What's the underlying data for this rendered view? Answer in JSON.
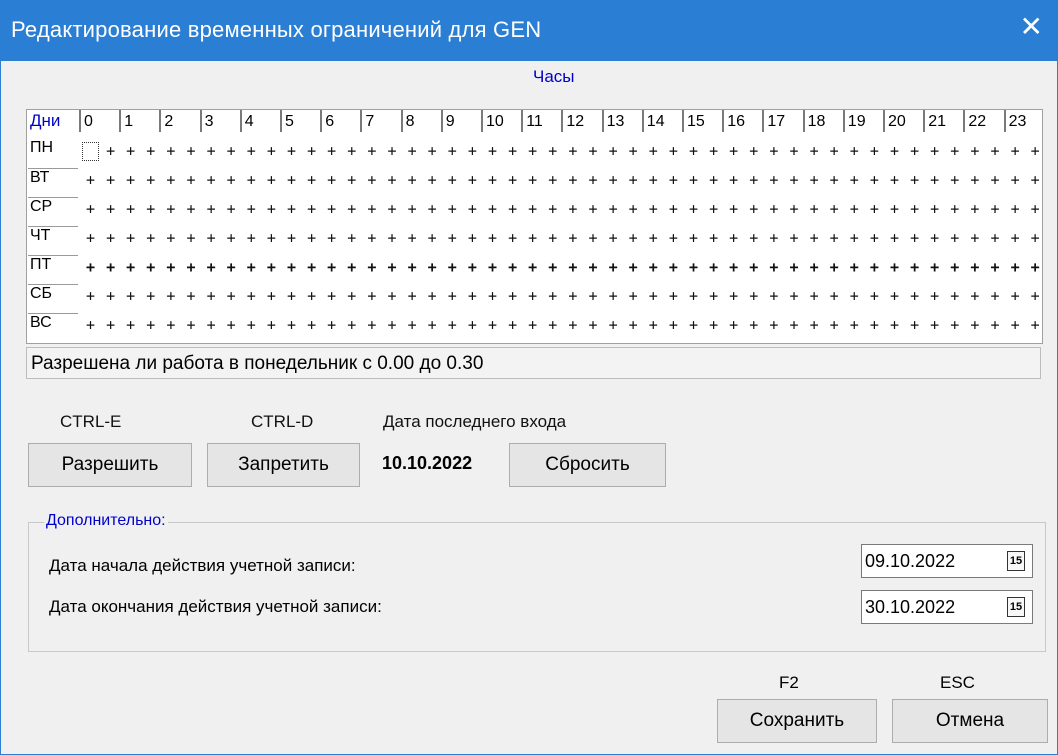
{
  "window": {
    "title": "Редактирование временных ограничений для GEN",
    "close_label": "✕"
  },
  "schedule": {
    "hours_caption": "Часы",
    "days_caption": "Дни",
    "hours": [
      "0",
      "1",
      "2",
      "3",
      "4",
      "5",
      "6",
      "7",
      "8",
      "9",
      "10",
      "11",
      "12",
      "13",
      "14",
      "15",
      "16",
      "17",
      "18",
      "19",
      "20",
      "21",
      "22",
      "23"
    ],
    "days": [
      "ПН",
      "ВТ",
      "СР",
      "ЧТ",
      "ПТ",
      "СБ",
      "ВС"
    ],
    "cell_symbol": "+",
    "allowed_all": true,
    "bold_day_index": 4
  },
  "status": {
    "text": "Разрешена ли работа в понедельник с 0.00 до 0.30"
  },
  "actions": {
    "allow_hint": "CTRL-E",
    "allow_label": "Разрешить",
    "deny_hint": "CTRL-D",
    "deny_label": "Запретить",
    "last_login_label": "Дата последнего входа",
    "last_login_date": "10.10.2022",
    "reset_label": "Сбросить"
  },
  "extra": {
    "legend": "Дополнительно:",
    "start_label": "Дата начала действия учетной записи:",
    "start_value": "09.10.2022",
    "end_label": "Дата окончания действия учетной записи:",
    "end_value": "30.10.2022",
    "calendar_icon_glyph": "15"
  },
  "footer": {
    "save_hint": "F2",
    "save_label": "Сохранить",
    "cancel_hint": "ESC",
    "cancel_label": "Отмена"
  }
}
